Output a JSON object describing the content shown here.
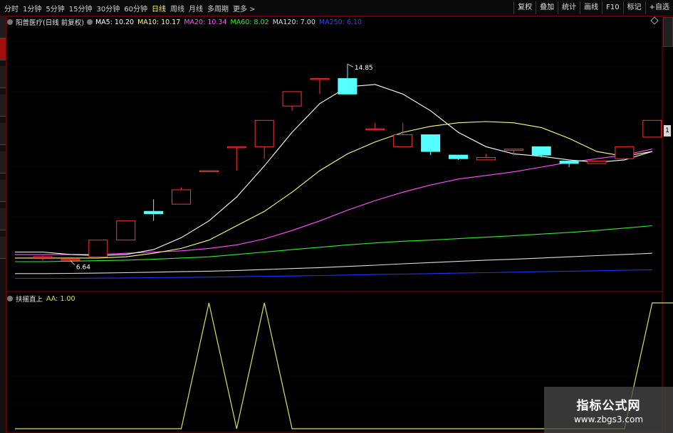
{
  "toolbar": {
    "periods": [
      {
        "label": "分时",
        "active": false
      },
      {
        "label": "1分钟",
        "active": false
      },
      {
        "label": "5分钟",
        "active": false
      },
      {
        "label": "15分钟",
        "active": false
      },
      {
        "label": "30分钟",
        "active": false
      },
      {
        "label": "60分钟",
        "active": false
      },
      {
        "label": "日线",
        "active": true
      },
      {
        "label": "周线",
        "active": false
      },
      {
        "label": "月线",
        "active": false
      },
      {
        "label": "多周期",
        "active": false
      },
      {
        "label": "更多 >",
        "active": false
      }
    ],
    "tools": [
      "复权",
      "叠加",
      "统计",
      "画线",
      "F10",
      "标记",
      "+自选"
    ]
  },
  "legend": {
    "stock": "阳普医疗(日线 前复权)",
    "ma5": "MA5: 10.20",
    "ma10": "MA10: 10.17",
    "ma20": "MA20: 10.34",
    "ma60": "MA60: 8.02",
    "ma120": "MA120: 7.00",
    "ma250": "MA250: 6.10"
  },
  "sub_legend": {
    "name": "扶摇直上",
    "aa": "AA: 1.00"
  },
  "scroll_label": "1",
  "watermark": {
    "title": "指标公式网",
    "url": "www.zbgs3.com"
  },
  "colors": {
    "up": "#ff3333",
    "down": "#54ffff",
    "ma5": "#ffffff",
    "ma10": "#ffff88",
    "ma20": "#ff55ff",
    "ma60": "#33ee33",
    "ma120": "#dddddd",
    "ma250": "#2233ff",
    "aa": "#dddd66",
    "border": "#8b0000"
  },
  "chart_data": {
    "type": "candlestick",
    "price_range": [
      5.5,
      16.4
    ],
    "annotations": {
      "high": "14.85",
      "low": "6.64"
    },
    "candles": [
      {
        "o": 6.81,
        "h": 6.86,
        "l": 6.64,
        "c": 6.81
      },
      {
        "o": 6.7,
        "h": 6.8,
        "l": 6.64,
        "c": 6.7
      },
      {
        "o": 6.8,
        "h": 7.5,
        "l": 6.8,
        "c": 7.5
      },
      {
        "o": 7.5,
        "h": 8.3,
        "l": 7.5,
        "c": 8.3
      },
      {
        "o": 8.7,
        "h": 9.2,
        "l": 8.3,
        "c": 8.6
      },
      {
        "o": 9.0,
        "h": 9.7,
        "l": 9.0,
        "c": 9.6
      },
      {
        "o": 10.4,
        "h": 10.4,
        "l": 10.4,
        "c": 10.4
      },
      {
        "o": 11.4,
        "h": 11.4,
        "l": 10.4,
        "c": 11.4
      },
      {
        "o": 11.4,
        "h": 12.5,
        "l": 10.9,
        "c": 12.5
      },
      {
        "o": 13.1,
        "h": 13.7,
        "l": 12.9,
        "c": 13.7
      },
      {
        "o": 14.25,
        "h": 14.25,
        "l": 13.6,
        "c": 14.25
      },
      {
        "o": 14.25,
        "h": 14.85,
        "l": 13.6,
        "c": 13.6
      },
      {
        "o": 12.15,
        "h": 12.4,
        "l": 12.15,
        "c": 12.15
      },
      {
        "o": 11.4,
        "h": 12.4,
        "l": 11.4,
        "c": 11.9
      },
      {
        "o": 11.9,
        "h": 11.9,
        "l": 11.05,
        "c": 11.2
      },
      {
        "o": 11.05,
        "h": 11.05,
        "l": 10.85,
        "c": 10.9
      },
      {
        "o": 10.85,
        "h": 11.1,
        "l": 10.85,
        "c": 10.95
      },
      {
        "o": 11.25,
        "h": 11.25,
        "l": 11.05,
        "c": 11.3
      },
      {
        "o": 11.4,
        "h": 11.4,
        "l": 10.95,
        "c": 11.05
      },
      {
        "o": 10.8,
        "h": 10.8,
        "l": 10.55,
        "c": 10.7
      },
      {
        "o": 10.7,
        "h": 10.8,
        "l": 10.7,
        "c": 10.8
      },
      {
        "o": 10.9,
        "h": 11.4,
        "l": 10.9,
        "c": 11.4
      },
      {
        "o": 11.8,
        "h": 12.5,
        "l": 11.8,
        "c": 12.5
      }
    ],
    "ma_series": {
      "ma5": [
        7.0,
        6.9,
        6.85,
        6.9,
        7.1,
        7.6,
        8.3,
        9.3,
        10.6,
        12.0,
        13.2,
        13.9,
        14.0,
        13.6,
        12.9,
        12.0,
        11.4,
        11.1,
        11.0,
        10.85,
        10.75,
        10.85,
        11.2
      ],
      "ma10": [
        6.75,
        6.75,
        6.75,
        6.8,
        6.95,
        7.15,
        7.5,
        8.1,
        8.7,
        9.5,
        10.4,
        11.1,
        11.6,
        12.0,
        12.25,
        12.4,
        12.45,
        12.4,
        12.2,
        11.75,
        11.2,
        11.0,
        11.2
      ],
      "ma20": [
        6.9,
        6.9,
        6.9,
        6.95,
        7.0,
        7.05,
        7.15,
        7.3,
        7.55,
        7.9,
        8.3,
        8.75,
        9.15,
        9.5,
        9.8,
        10.05,
        10.2,
        10.35,
        10.55,
        10.75,
        10.9,
        11.05,
        11.3
      ],
      "ma60": [
        6.6,
        6.62,
        6.64,
        6.66,
        6.7,
        6.75,
        6.8,
        6.9,
        7.0,
        7.1,
        7.2,
        7.3,
        7.38,
        7.45,
        7.5,
        7.56,
        7.62,
        7.68,
        7.75,
        7.82,
        7.9,
        8.0,
        8.1
      ],
      "ma120": [
        6.1,
        6.11,
        6.12,
        6.14,
        6.16,
        6.18,
        6.2,
        6.23,
        6.27,
        6.31,
        6.35,
        6.4,
        6.45,
        6.51,
        6.56,
        6.61,
        6.66,
        6.7,
        6.75,
        6.8,
        6.85,
        6.9,
        6.95
      ],
      "ma250": [
        5.9,
        5.9,
        5.91,
        5.92,
        5.93,
        5.94,
        5.95,
        5.97,
        5.99,
        6.0,
        6.02,
        6.04,
        6.06,
        6.08,
        6.1,
        6.12,
        6.14,
        6.16,
        6.18,
        6.2,
        6.22,
        6.24,
        6.26
      ]
    },
    "indicator": {
      "name": "扶摇直上",
      "range": [
        0,
        1
      ],
      "values": [
        0,
        0,
        0,
        0,
        0,
        0,
        1,
        0,
        1,
        0,
        0,
        0,
        0,
        0,
        0,
        0,
        0,
        0,
        0,
        0,
        0,
        0,
        1,
        1
      ]
    }
  }
}
